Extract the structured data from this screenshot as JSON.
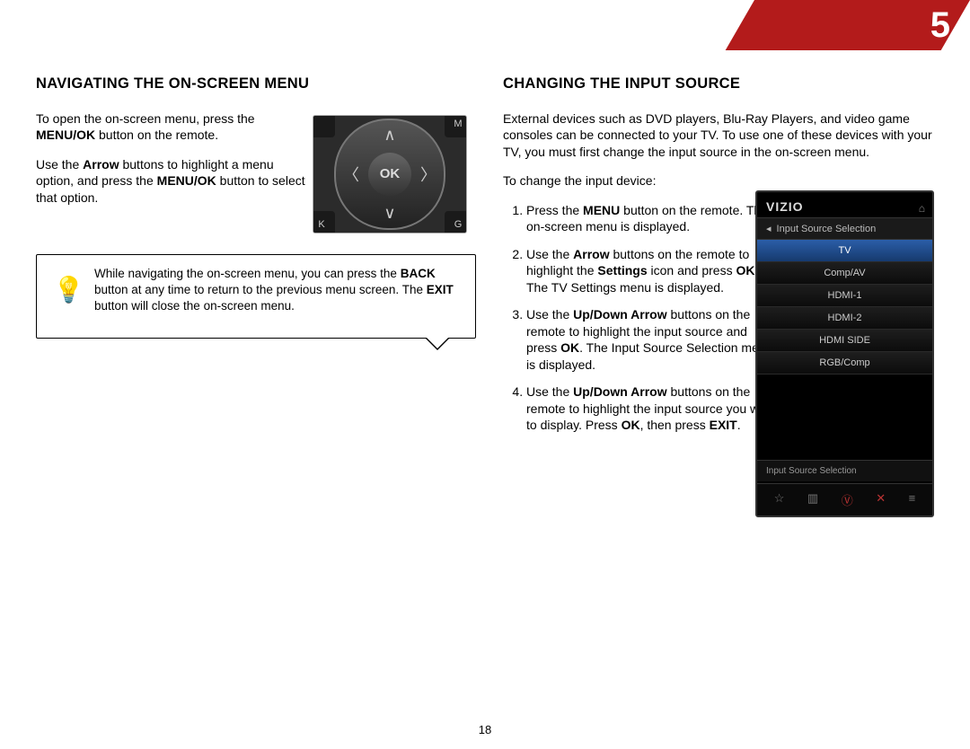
{
  "chapter_number": "5",
  "footer_page": "18",
  "left": {
    "heading": "NAVIGATING THE ON-SCREEN MENU",
    "p1_a": "To open the on-screen menu, press the ",
    "p1_b": "MENU/OK",
    "p1_c": " button on the remote.",
    "p2_a": "Use the ",
    "p2_b": "Arrow",
    "p2_c": " buttons to highlight a menu option, and press the ",
    "p2_d": "MENU/OK",
    "p2_e": " button to select that option.",
    "tip_a": "While navigating the on-screen menu, you can press the ",
    "tip_b": "BACK",
    "tip_c": " button at any time to return to the previous menu screen. The ",
    "tip_d": "EXIT",
    "tip_e": " button will close the on-screen menu."
  },
  "remote": {
    "ok": "OK",
    "tl": "",
    "tr": "M",
    "bl": "K",
    "br": "G"
  },
  "right": {
    "heading": "CHANGING THE INPUT SOURCE",
    "intro": "External devices such as DVD players, Blu-Ray Players, and video game consoles can be connected to your TV. To use one of these devices with your TV, you must first change the input source in the on-screen menu.",
    "lead": "To change the input device:",
    "s1_a": "Press the ",
    "s1_b": "MENU",
    "s1_c": " button on the remote. The on-screen menu is displayed.",
    "s2_a": "Use the ",
    "s2_b": "Arrow",
    "s2_c": " buttons on the remote to highlight the ",
    "s2_d": "Settings",
    "s2_e": " icon and press ",
    "s2_f": "OK",
    "s2_g": ". The TV Settings menu is displayed.",
    "s3_a": "Use the ",
    "s3_b": "Up/Down Arrow",
    "s3_c": " buttons on the remote to highlight the input source and press ",
    "s3_d": "OK",
    "s3_e": ". The Input Source Selection menu is displayed.",
    "s4_a": "Use the ",
    "s4_b": "Up/Down Arrow",
    "s4_c": " buttons on the remote to highlight the input source you wish to display. Press ",
    "s4_d": "OK",
    "s4_e": ", then press ",
    "s4_f": "EXIT",
    "s4_g": "."
  },
  "tv": {
    "logo": "VIZIO",
    "header": "Input Source Selection",
    "items": [
      "TV",
      "Comp/AV",
      "HDMI-1",
      "HDMI-2",
      "HDMI SIDE",
      "RGB/Comp"
    ],
    "footer": "Input Source Selection"
  }
}
